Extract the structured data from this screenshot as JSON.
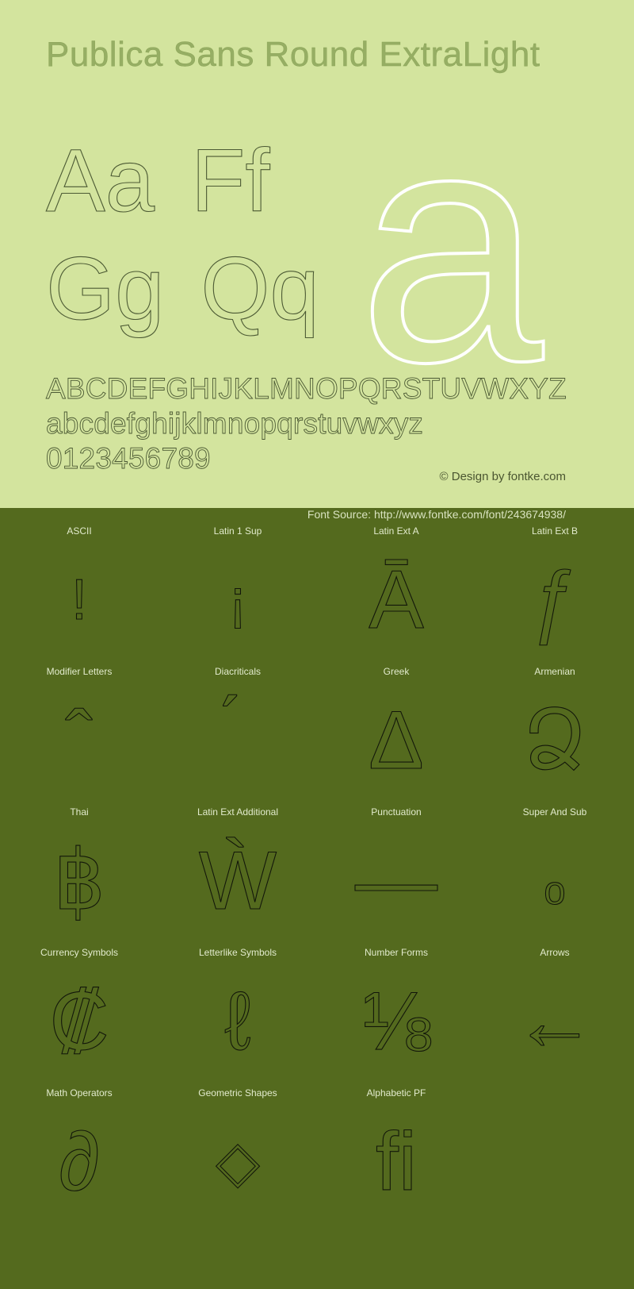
{
  "page": {
    "title": "Publica Sans Round ExtraLight",
    "top_bg": "#d3e49e",
    "bottom_bg": "#546a1e",
    "title_color": "#96ae64",
    "glyph_color": "#4c5a34",
    "accent_white": "#ffffff"
  },
  "preview": {
    "pairs_row1": "Aa",
    "pairs_row1b": "Ff",
    "pairs_row2": "Gg",
    "pairs_row2b": "Qq",
    "giant_glyph": "a",
    "uppercase": "ABCDEFGHIJKLMNOPQRSTUVWXYZ",
    "lowercase": "abcdefghijklmnopqrstuvwxyz",
    "digits": "0123456789"
  },
  "credits": {
    "copyright": "© Design by fontke.com",
    "font_source": "Font Source: http://www.fontke.com/font/243674938/"
  },
  "coverage": {
    "rows": [
      [
        {
          "label": "ASCII",
          "glyph": "!",
          "size": "small"
        },
        {
          "label": "Latin 1 Sup",
          "glyph": "¡",
          "size": "small"
        },
        {
          "label": "Latin Ext A",
          "glyph": "Ā",
          "size": "normal"
        },
        {
          "label": "Latin Ext B",
          "glyph": "ƒ",
          "size": "normal"
        }
      ],
      [
        {
          "label": "Modifier Letters",
          "glyph": "ˆ",
          "size": "normal"
        },
        {
          "label": "Diacriticals",
          "glyph": "́",
          "size": "normal"
        },
        {
          "label": "Greek",
          "glyph": "Δ",
          "size": "normal"
        },
        {
          "label": "Armenian",
          "glyph": "Ձ",
          "size": "normal"
        }
      ],
      [
        {
          "label": "Thai",
          "glyph": "฿",
          "size": "normal"
        },
        {
          "label": "Latin Ext Additional",
          "glyph": "Ẁ",
          "size": "normal"
        },
        {
          "label": "Punctuation",
          "glyph": "—",
          "size": "normal"
        },
        {
          "label": "Super And Sub",
          "glyph": "ₒ",
          "size": "small"
        }
      ],
      [
        {
          "label": "Currency Symbols",
          "glyph": "₡",
          "size": "normal"
        },
        {
          "label": "Letterlike Symbols",
          "glyph": "ℓ",
          "size": "normal"
        },
        {
          "label": "Number Forms",
          "glyph": "⅛",
          "size": "normal"
        },
        {
          "label": "Arrows",
          "glyph": "←",
          "size": "normal"
        }
      ],
      [
        {
          "label": "Math Operators",
          "glyph": "∂",
          "size": "normal"
        },
        {
          "label": "Geometric Shapes",
          "glyph": "◇",
          "size": "small"
        },
        {
          "label": "Alphabetic PF",
          "glyph": "ﬁ",
          "size": "normal"
        },
        {
          "label": "",
          "glyph": "",
          "size": "normal"
        }
      ]
    ]
  }
}
